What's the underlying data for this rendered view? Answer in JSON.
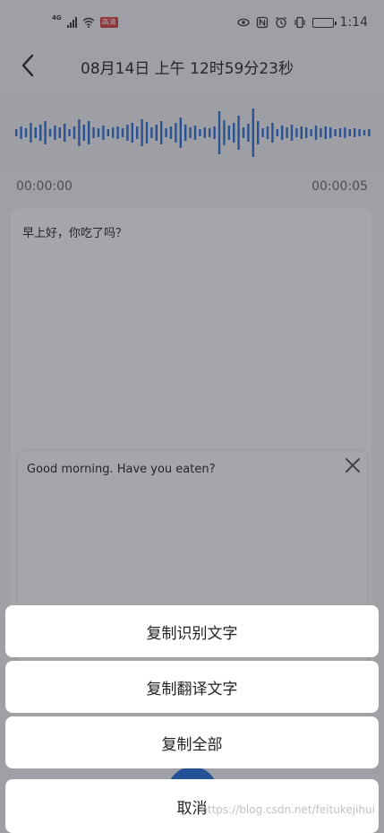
{
  "status_bar": {
    "network_label": "4G",
    "hd_badge": "高清",
    "time": "1:14"
  },
  "header": {
    "title": "08月14日 上午 12时59分23秒"
  },
  "playback": {
    "start_time": "00:00:00",
    "end_time": "00:00:05"
  },
  "transcript": {
    "text": "早上好，你吃了吗？"
  },
  "translation": {
    "text": "Good morning. Have you eaten?"
  },
  "action_sheet": {
    "copy_recognized_label": "复制识别文字",
    "copy_translated_label": "复制翻译文字",
    "copy_all_label": "复制全部",
    "cancel_label": "取消"
  },
  "watermark": "https://blog.csdn.net/feitukejihui",
  "colors": {
    "accent": "#1f6fe0",
    "waveform": "#2d6fd6"
  }
}
